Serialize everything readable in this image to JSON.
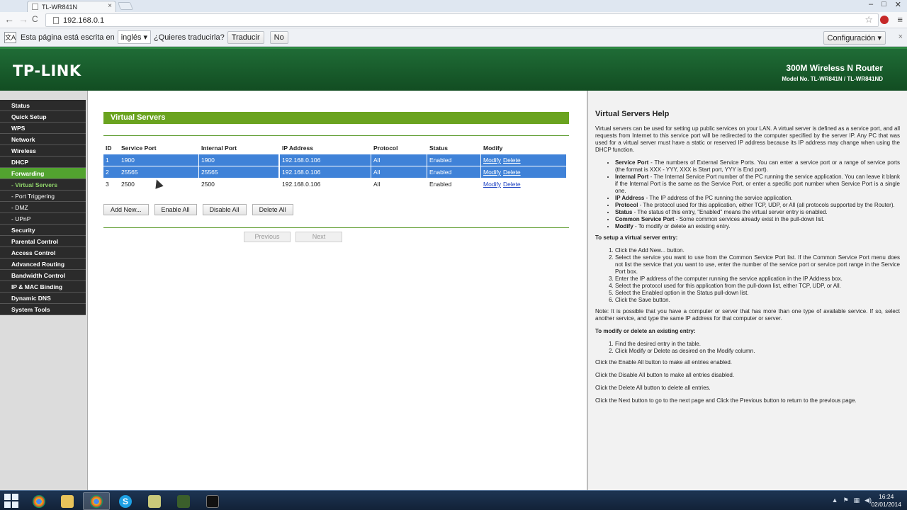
{
  "browser": {
    "tab_title": "TL-WR841N",
    "tab_close": "×",
    "url": "192.168.0.1",
    "window_controls": [
      "–",
      "□",
      "✕"
    ],
    "nav": {
      "back": "←",
      "forward": "→",
      "reload": "C"
    },
    "star": "☆",
    "menu": "≡"
  },
  "translate_bar": {
    "icon": "文A",
    "message": "Esta página está escrita en",
    "language": "inglés",
    "question": "¿Quieres traducirla?",
    "translate_btn": "Traducir",
    "no_btn": "No",
    "config_btn": "Configuración",
    "close": "×"
  },
  "banner": {
    "logo": "TP-LINK",
    "product": "300M Wireless N Router",
    "model": "Model No. TL-WR841N / TL-WR841ND"
  },
  "sidebar": {
    "items": [
      {
        "label": "Status",
        "type": "main"
      },
      {
        "label": "Quick Setup",
        "type": "main"
      },
      {
        "label": "WPS",
        "type": "main"
      },
      {
        "label": "Network",
        "type": "main"
      },
      {
        "label": "Wireless",
        "type": "main"
      },
      {
        "label": "DHCP",
        "type": "main"
      },
      {
        "label": "Forwarding",
        "type": "active"
      },
      {
        "label": "- Virtual Servers",
        "type": "sub-current"
      },
      {
        "label": "- Port Triggering",
        "type": "sub"
      },
      {
        "label": "- DMZ",
        "type": "sub"
      },
      {
        "label": "- UPnP",
        "type": "sub"
      },
      {
        "label": "Security",
        "type": "main"
      },
      {
        "label": "Parental Control",
        "type": "main"
      },
      {
        "label": "Access Control",
        "type": "main"
      },
      {
        "label": "Advanced Routing",
        "type": "main"
      },
      {
        "label": "Bandwidth Control",
        "type": "main"
      },
      {
        "label": "IP & MAC Binding",
        "type": "main"
      },
      {
        "label": "Dynamic DNS",
        "type": "main"
      },
      {
        "label": "System Tools",
        "type": "main"
      }
    ]
  },
  "main": {
    "title": "Virtual Servers",
    "headers": {
      "id": "ID",
      "service": "Service Port",
      "internal": "Internal Port",
      "ip": "IP Address",
      "protocol": "Protocol",
      "status": "Status",
      "modify": "Modify"
    },
    "rows": [
      {
        "id": "1",
        "service": "1900",
        "internal": "1900",
        "ip": "192.168.0.106",
        "protocol": "All",
        "status": "Enabled",
        "modify": "Modify",
        "delete": "Delete",
        "selected": true
      },
      {
        "id": "2",
        "service": "25565",
        "internal": "25565",
        "ip": "192.168.0.106",
        "protocol": "All",
        "status": "Enabled",
        "modify": "Modify",
        "delete": "Delete",
        "selected": true
      },
      {
        "id": "3",
        "service": "2500",
        "internal": "2500",
        "ip": "192.168.0.106",
        "protocol": "All",
        "status": "Enabled",
        "modify": "Modify",
        "delete": "Delete",
        "selected": false
      }
    ],
    "buttons": {
      "add": "Add New...",
      "enable": "Enable All",
      "disable": "Disable All",
      "delete": "Delete All"
    },
    "pager": {
      "prev": "Previous",
      "next": "Next"
    }
  },
  "help": {
    "title": "Virtual Servers Help",
    "intro": "Virtual servers can be used for setting up public services on your LAN. A virtual server is defined as a service port, and all requests from Internet to this service port will be redirected to the computer specified by the server IP. Any PC that was used for a virtual server must have a static or reserved IP address because its IP address may change when using the DHCP function.",
    "defs": [
      {
        "term": "Service Port",
        "text": " - The numbers of External Service Ports. You can enter a service port or a range of service ports (the format is XXX - YYY, XXX is Start port, YYY is End port)."
      },
      {
        "term": "Internal Port",
        "text": " - The Internal Service Port number of the PC running the service application. You can leave it blank if the Internal Port is the same as the Service Port, or enter a specific port number when Service Port is a single one."
      },
      {
        "term": "IP Address",
        "text": " - The IP address of the PC running the service application."
      },
      {
        "term": "Protocol",
        "text": " - The protocol used for this application, either TCP, UDP, or All (all protocols supported by the Router)."
      },
      {
        "term": "Status",
        "text": " - The status of this entry, \"Enabled\" means the virtual server entry is enabled."
      },
      {
        "term": "Common Service Port",
        "text": " - Some common services already exist in the pull-down list."
      },
      {
        "term": "Modify",
        "text": " - To modify or delete an existing entry."
      }
    ],
    "setup_heading": "To setup a virtual server entry:",
    "setup_steps": [
      "Click the Add New... button.",
      "Select the service you want to use from the Common Service Port list. If the Common Service Port menu does not list the service that you want to use, enter the number of the service port or service port range in the Service Port box.",
      "Enter the IP address of the computer running the service application in the IP Address box.",
      "Select the protocol used for this application from the pull-down list, either TCP, UDP, or All.",
      "Select the Enabled option in the Status pull-down list.",
      "Click the Save button."
    ],
    "note": "Note: It is possible that you have a computer or server that has more than one type of available service. If so, select another service, and type the same IP address for that computer or server.",
    "modify_heading": "To modify or delete an existing entry:",
    "modify_steps": [
      "Find the desired entry in the table.",
      "Click Modify or Delete as desired on the Modify column."
    ],
    "enable_all": "Click the Enable All button to make all entries enabled.",
    "disable_all": "Click the Disable All button to make all entries disabled.",
    "delete_all": "Click the Delete All button to delete all entries.",
    "next_prev": "Click the Next button to go to the next page and Click the Previous button to return to the previous page."
  },
  "taskbar": {
    "time": "16:24",
    "date": "02/01/2014"
  }
}
